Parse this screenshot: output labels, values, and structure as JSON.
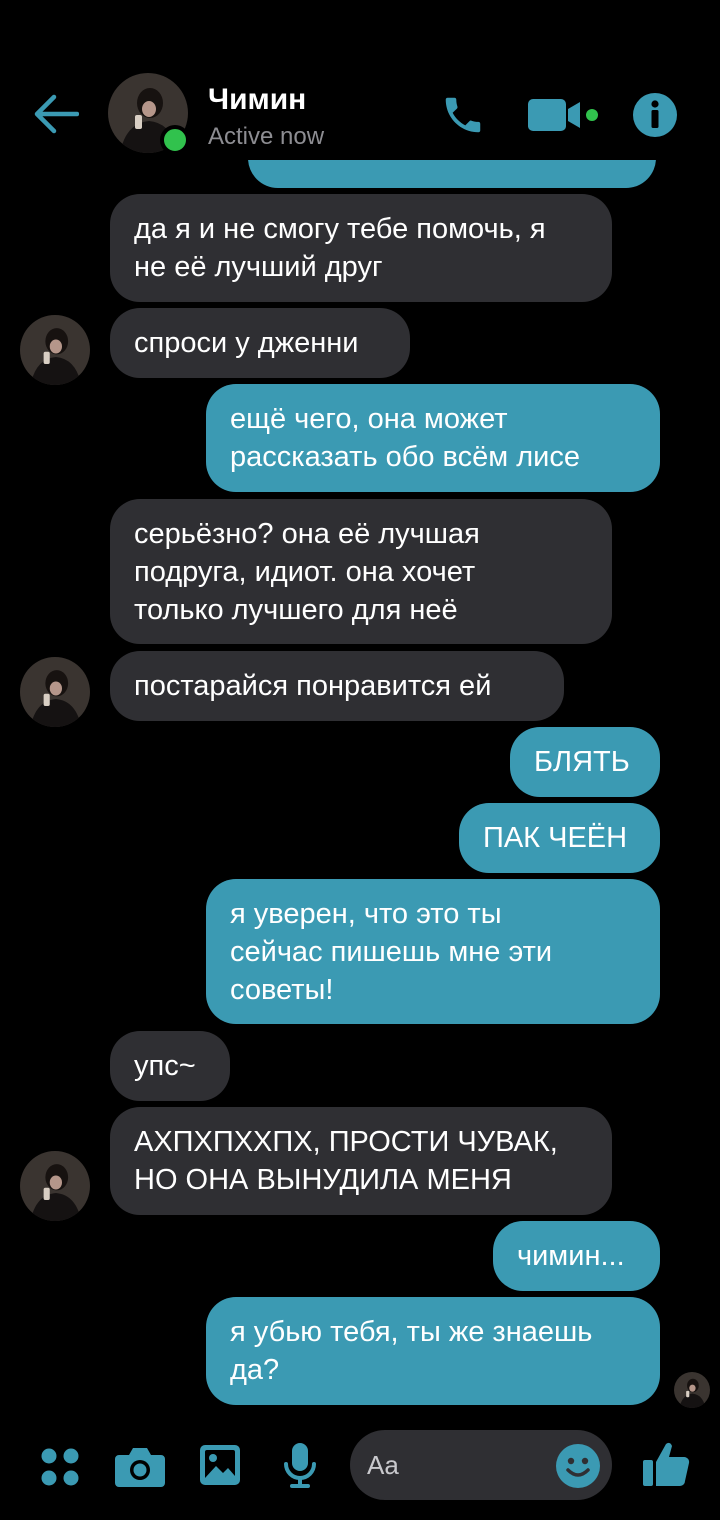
{
  "header": {
    "contact_name": "Чимин",
    "status": "Active now",
    "back_icon": "arrow-left-icon",
    "call_icon": "phone-icon",
    "video_icon": "video-camera-icon",
    "info_icon": "info-icon",
    "accent_color": "#3b9ab3",
    "online_color": "#31c24d"
  },
  "messages": [
    {
      "side": "in",
      "text": "да я и не смогу тебе помочь, я\nне её лучший друг"
    },
    {
      "side": "in",
      "text": "спроси у дженни"
    },
    {
      "side": "out",
      "text": "ещё чего, она может\nрассказать обо всём лисе"
    },
    {
      "side": "in",
      "text": "серьёзно? она её лучшая\nподруга, идиот. она хочет\nтолько лучшего для неё"
    },
    {
      "side": "in",
      "text": "постарайся понравится ей"
    },
    {
      "side": "out",
      "text": "БЛЯТЬ"
    },
    {
      "side": "out",
      "text": "ПАК ЧЕЁН"
    },
    {
      "side": "out",
      "text": "я уверен, что это ты\nсейчас пишешь мне эти\nсоветы!"
    },
    {
      "side": "in",
      "text": "упс~"
    },
    {
      "side": "in",
      "text": "АХПХПХХПХ, ПРОСТИ ЧУВАК,\nНО ОНА ВЫНУДИЛА МЕНЯ"
    },
    {
      "side": "out",
      "text": "чимин..."
    },
    {
      "side": "out",
      "text": "я убью тебя, ты же знаешь\nда?"
    }
  ],
  "composer": {
    "placeholder": "Aa",
    "icons": [
      "apps-grid-icon",
      "camera-icon",
      "gallery-icon",
      "microphone-icon",
      "emoji-icon",
      "thumbs-up-icon"
    ]
  },
  "colors": {
    "incoming_bubble": "#2f2f33",
    "outgoing_bubble": "#3b9ab3",
    "background": "#000000"
  }
}
